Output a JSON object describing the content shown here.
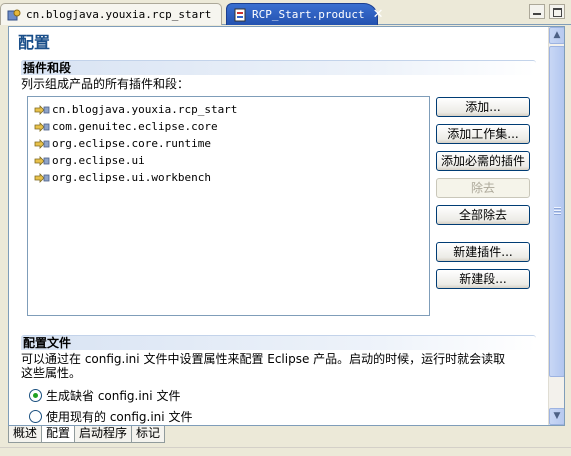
{
  "tabs": [
    {
      "label": "cn.blogjava.youxia.rcp_start",
      "active": false,
      "icon": "plugin-project-icon"
    },
    {
      "label": "RCP_Start.product",
      "active": true,
      "icon": "product-file-icon"
    }
  ],
  "page": {
    "title": "配置"
  },
  "plugins_section": {
    "header": "插件和段",
    "description": "列示组成产品的所有插件和段：",
    "items": [
      "cn.blogjava.youxia.rcp_start",
      "com.genuitec.eclipse.core",
      "org.eclipse.core.runtime",
      "org.eclipse.ui",
      "org.eclipse.ui.workbench"
    ],
    "buttons": {
      "add": "添加...",
      "add_working_set": "添加工作集...",
      "add_required": "添加必需的插件",
      "remove": "除去",
      "remove_all": "全部除去",
      "new_plugin": "新建插件...",
      "new_fragment": "新建段..."
    }
  },
  "config_section": {
    "header": "配置文件",
    "description_line1": "可以通过在 config.ini 文件中设置属性来配置 Eclipse 产品。启动的时候，运行时就会读取",
    "description_line2": "这些属性。",
    "options": [
      {
        "label": "生成缺省 config.ini 文件",
        "checked": true
      },
      {
        "label": "使用现有的 config.ini 文件",
        "checked": false
      }
    ]
  },
  "page_tabs": [
    "概述",
    "配置",
    "启动程序",
    "标记"
  ],
  "colors": {
    "accent": "#2452b0",
    "title": "#1a4f8a",
    "radio_dot": "#21a121"
  }
}
